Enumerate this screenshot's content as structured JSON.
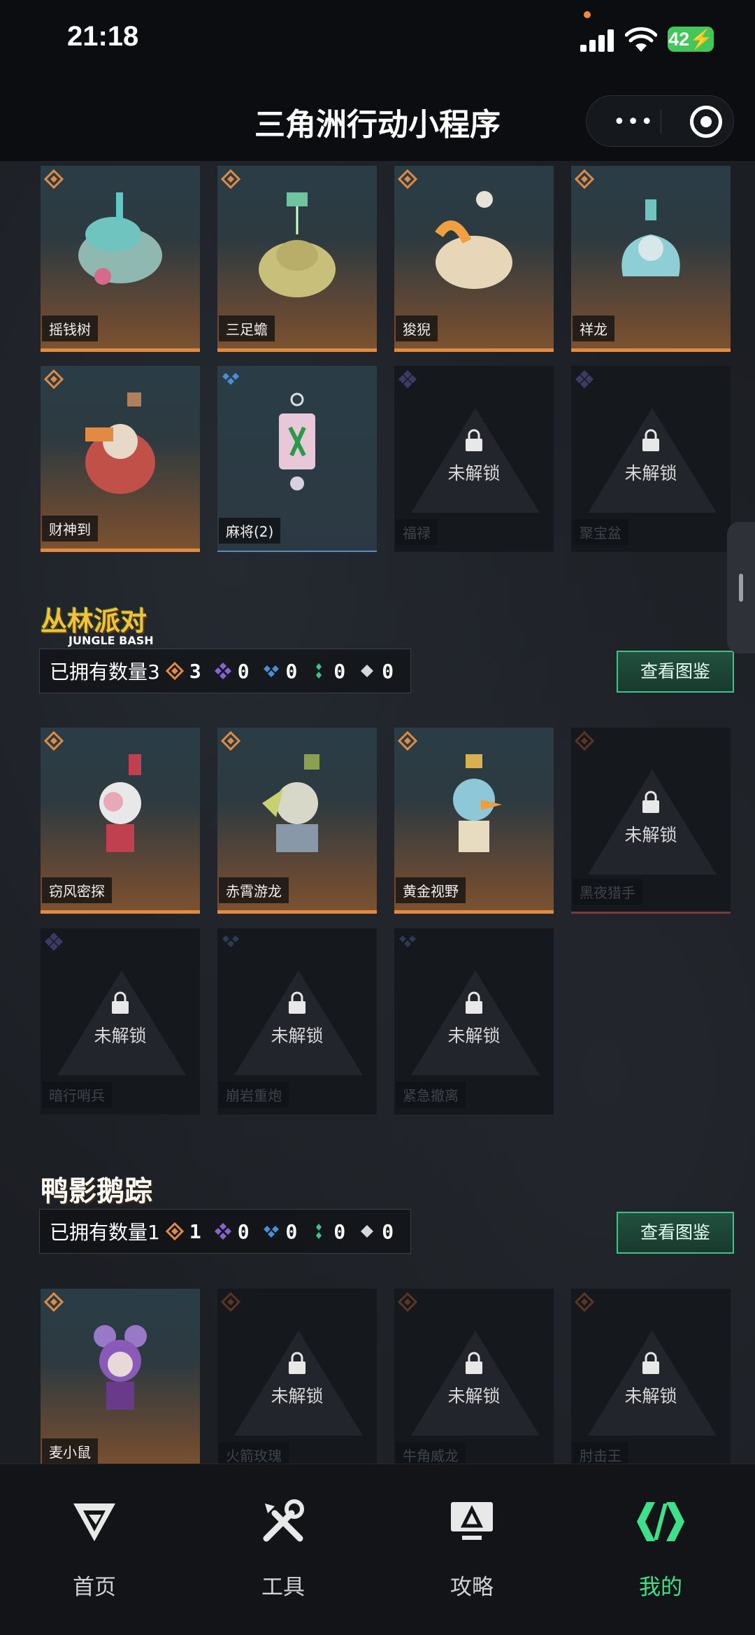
{
  "status_bar": {
    "time": "21:18",
    "battery": "42"
  },
  "nav": {
    "title": "三角洲行动小程序",
    "more_label": "•••"
  },
  "colors": {
    "accent_green": "#3ee08a",
    "orange_rarity": "#e08a42",
    "purple_rarity": "#8a62d8",
    "blue_rarity": "#4a8fd6",
    "green_rarity": "#3ec48a"
  },
  "lock": {
    "text": "未解锁"
  },
  "section0": {
    "row1": [
      "摇钱树",
      "三足蟾",
      "狻猊",
      "祥龙"
    ],
    "row2": [
      "财神到",
      "麻将(2)",
      "福禄",
      "聚宝盆"
    ]
  },
  "section1": {
    "logo": "丛林派对",
    "logo_sub": "JUNGLE BASH",
    "owned_label": "已拥有数量3",
    "counts": [
      "3",
      "0",
      "0",
      "0",
      "0"
    ],
    "view_button": "查看图鉴",
    "row1": [
      "窃风密探",
      "赤霄游龙",
      "黄金视野",
      "黑夜猎手"
    ],
    "row2": [
      "暗行哨兵",
      "崩岩重炮",
      "紧急撤离"
    ]
  },
  "section2": {
    "logo": "鸭影鹅踪",
    "owned_label": "已拥有数量1",
    "counts": [
      "1",
      "0",
      "0",
      "0",
      "0"
    ],
    "view_button": "查看图鉴",
    "row1": [
      "麦小鼠",
      "火箭玫瑰",
      "牛角威龙",
      "肘击王"
    ]
  },
  "tabs": [
    {
      "label": "首页",
      "icon": "delta-logo-icon"
    },
    {
      "label": "工具",
      "icon": "tools-icon"
    },
    {
      "label": "攻略",
      "icon": "monitor-guide-icon"
    },
    {
      "label": "我的",
      "icon": "profile-logo-icon"
    }
  ]
}
